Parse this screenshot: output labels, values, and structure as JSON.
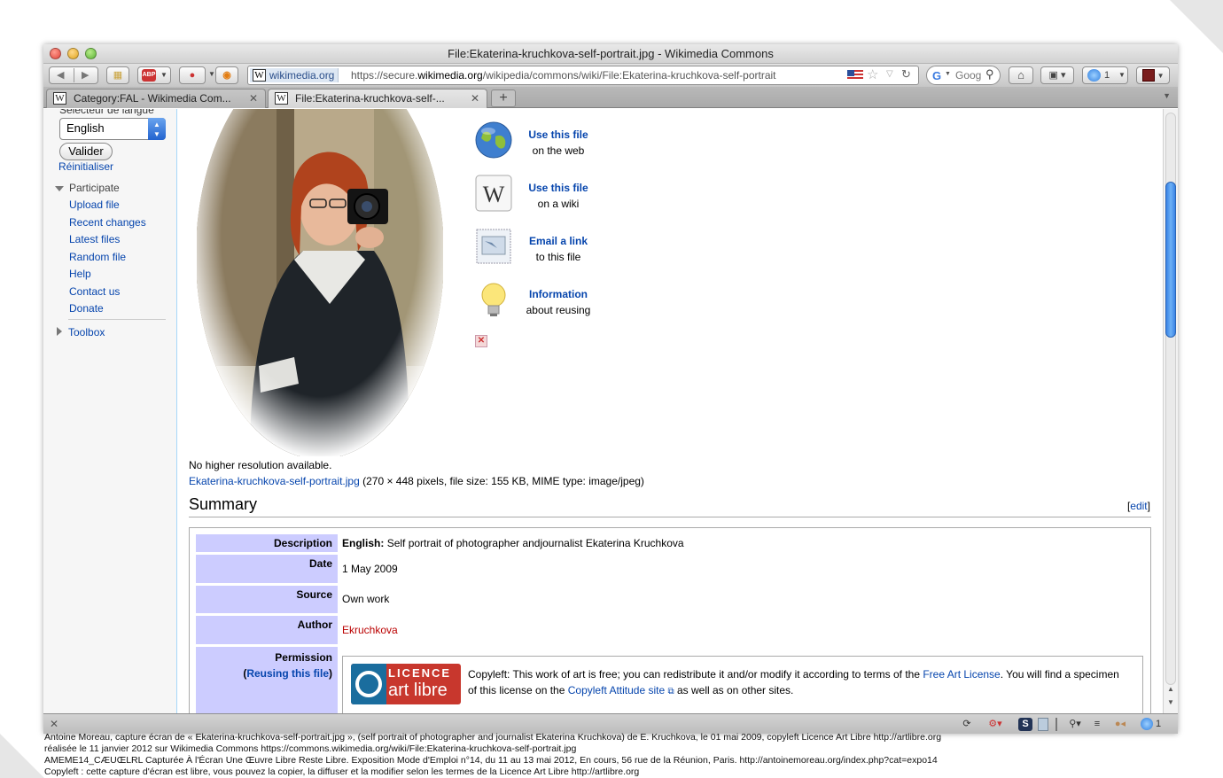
{
  "window": {
    "title": "File:Ekaterina-kruchkova-self-portrait.jpg - Wikimedia Commons"
  },
  "toolbar": {
    "site_identity": "wikimedia.org",
    "url_prefix": "https://secure.",
    "url_domain": "wikimedia.org",
    "url_path": "/wikipedia/commons/wiki/File:Ekaterina-kruchkova-self-portrait",
    "search_placeholder": "Goog",
    "adblock_label": "ABP",
    "notifications_count": "1"
  },
  "tabs": [
    {
      "label": "Category:FAL - Wikimedia Com...",
      "active": false
    },
    {
      "label": "File:Ekaterina-kruchkova-self-...",
      "active": true
    }
  ],
  "sidebar": {
    "lang_heading": "Sélecteur de langue",
    "lang_value": "English",
    "valider": "Valider",
    "reset": "Réinitialiser",
    "participate": "Participate",
    "links": [
      "Upload file",
      "Recent changes",
      "Latest files",
      "Random file",
      "Help",
      "Contact us",
      "Donate"
    ],
    "toolbox": "Toolbox"
  },
  "use_file": [
    {
      "title": "Use this file",
      "sub": "on the web",
      "icon": "globe-icon"
    },
    {
      "title": "Use this file",
      "sub": "on a wiki",
      "icon": "wikipedia-icon"
    },
    {
      "title": "Email a link",
      "sub": "to this file",
      "icon": "email-icon"
    },
    {
      "title": "Information",
      "sub": "about reusing",
      "icon": "lightbulb-icon"
    }
  ],
  "file": {
    "no_higher": "No higher resolution available.",
    "filename": "Ekaterina-kruchkova-self-portrait.jpg",
    "details": "(270 × 448 pixels, file size: 155 KB, MIME type: image/jpeg)"
  },
  "summary": {
    "heading": "Summary",
    "edit": "edit",
    "description_label": "Description",
    "description_lang": "English:",
    "description_text": "Self portrait of photographer andjournalist Ekaterina Kruchkova",
    "date_label": "Date",
    "date_value": "1 May 2009",
    "source_label": "Source",
    "source_value": "Own work",
    "author_label": "Author",
    "author_value": "Ekruchkova",
    "permission_label": "Permission",
    "reusing": "Reusing this file",
    "licence_word": "LICENCE",
    "art_libre": "art libre",
    "copyleft_1": "Copyleft: This work of art is free; you can redistribute it and/or modify it according to terms of the",
    "free_art_license": "Free Art License",
    "copyleft_2": ". You will find a specimen",
    "copyleft_3": "of this license on the",
    "copyleft_site": "Copyleft Attitude site",
    "copyleft_4": "as well as on other sites."
  },
  "status": {
    "count": "1"
  },
  "caption": [
    "Antoine Moreau, capture écran de « Ekaterina-kruchkova-self-portrait.jpg », (self portrait of photographer and journalist Ekaterina Kruchkova) de E. Kruchkova, le 01 mai 2009, copyleft Licence Art Libre http://artlibre.org",
    "réalisée le 11 janvier 2012 sur Wikimedia Commons https://commons.wikimedia.org/wiki/File:Ekaterina-kruchkova-self-portrait.jpg",
    "AMEME14_CÆUŒLRL Capturée À l'Écran Une Œuvre Libre Reste Libre. Exposition Mode d'Emploi n°14, du 11 au 13 mai 2012, En cours, 56 rue de la Réunion, Paris. http://antoinemoreau.org/index.php?cat=expo14",
    "Copyleft : cette capture d'écran est libre, vous pouvez la copier, la diffuser et la modifier selon les termes de la Licence Art Libre http://artlibre.org"
  ],
  "colors": {
    "link": "#0645ad",
    "table_header": "#ccccff",
    "author_red": "#ba0000",
    "licence_red": "#c8372d",
    "scroll_thumb": "#3a84e6"
  }
}
